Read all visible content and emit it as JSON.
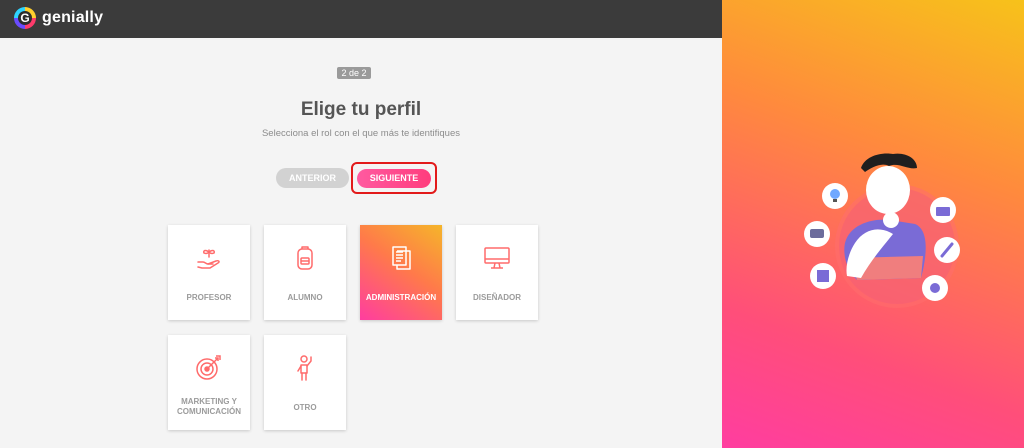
{
  "brand": {
    "name": "genially",
    "logo_letter": "G"
  },
  "step_indicator": "2 de 2",
  "title": "Elige tu perfil",
  "subtitle": "Selecciona el rol con el que más te identifiques",
  "buttons": {
    "prev": "ANTERIOR",
    "next": "SIGUIENTE"
  },
  "profiles": [
    {
      "label": "PROFESOR",
      "icon": "hand-plant-icon",
      "selected": false
    },
    {
      "label": "ALUMNO",
      "icon": "backpack-icon",
      "selected": false
    },
    {
      "label": "ADMINISTRACIÓN",
      "icon": "documents-icon",
      "selected": true
    },
    {
      "label": "DISEÑADOR",
      "icon": "monitor-icon",
      "selected": false
    },
    {
      "label": "MARKETING Y COMUNICACIÓN",
      "label_line1": "MARKETING Y",
      "label_line2": "COMUNICACIÓN",
      "icon": "target-icon",
      "selected": false
    },
    {
      "label": "OTRO",
      "icon": "person-waving-icon",
      "selected": false
    }
  ],
  "colors": {
    "accent": "#ff3d7d",
    "topbar": "#3b3b3b",
    "highlight": "#e21a1a"
  }
}
